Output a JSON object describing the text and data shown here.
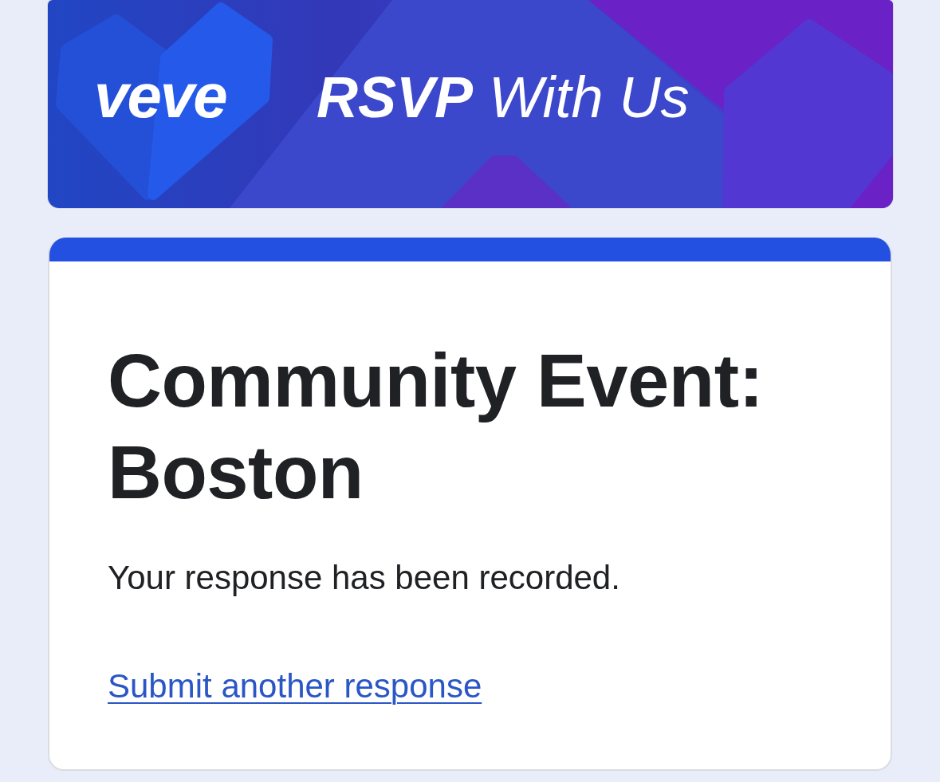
{
  "banner": {
    "logo": "veve",
    "headline": "**RSVP** With Us"
  },
  "form": {
    "title": "Community Event: Boston",
    "message": "Your response has been recorded.",
    "link": "Submit another response"
  }
}
